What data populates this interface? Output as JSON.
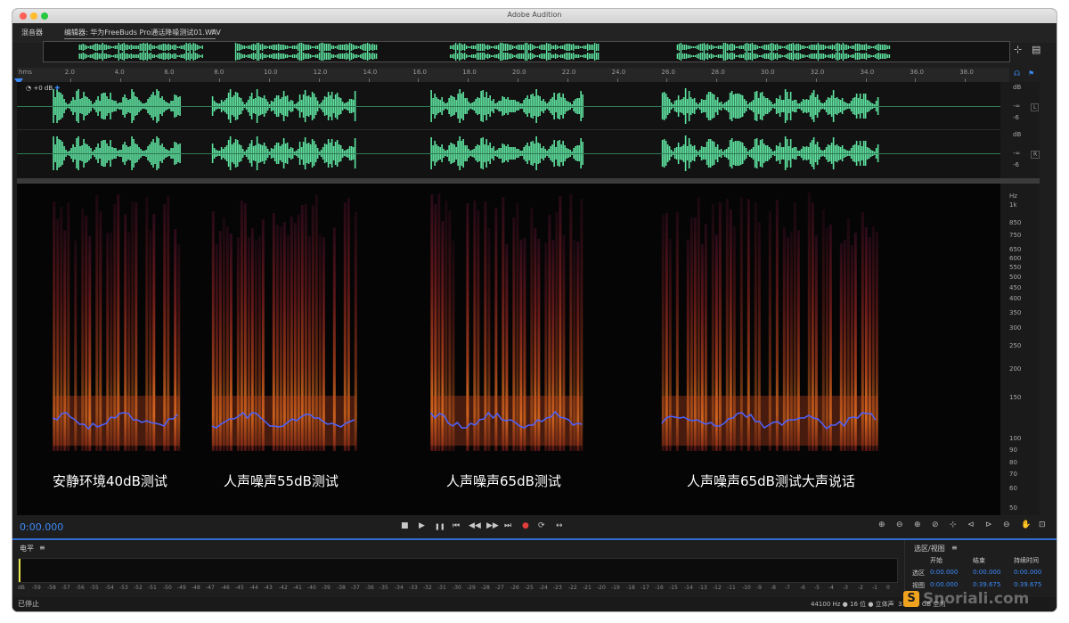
{
  "window": {
    "title": "Adobe Audition"
  },
  "tabs": {
    "mixer": "混音器",
    "editor": "编辑器: 华为FreeBuds Pro通话降噪测试01.WAV",
    "menu_glyph": "≡"
  },
  "ruler": {
    "unit": "hms",
    "labels": [
      "2.0",
      "4.0",
      "6.0",
      "8.0",
      "10.0",
      "12.0",
      "14.0",
      "16.0",
      "18.0",
      "20.0",
      "22.0",
      "24.0",
      "26.0",
      "28.0",
      "30.0",
      "32.0",
      "34.0",
      "36.0",
      "38.0"
    ]
  },
  "waveform": {
    "hud_volume": "+0 dB",
    "db_top": "dB",
    "db_inf": "-∞",
    "db_neg6": "-6",
    "left_tag": "L",
    "right_tag": "R"
  },
  "spectral": {
    "hz_unit": "Hz",
    "hz_labels": [
      "1k",
      "850",
      "750",
      "650",
      "600",
      "550",
      "500",
      "450",
      "400",
      "350",
      "300",
      "250",
      "200",
      "150",
      "100",
      "90",
      "80",
      "70",
      "60",
      "50"
    ],
    "captions": [
      "安静环境40dB测试",
      "人声噪声55dB测试",
      "人声噪声65dB测试",
      "人声噪声65dB测试大声说话"
    ]
  },
  "transport": {
    "timecode": "0:00.000",
    "stop": "■",
    "play": "▶",
    "pause": "❚❚",
    "to_start": "⏮",
    "rewind": "◀◀",
    "fast_forward": "▶▶",
    "to_end": "⏭",
    "record": "●",
    "loop": "⟳",
    "skip": "↔"
  },
  "levels": {
    "title": "电平",
    "menu": "≡",
    "scale": [
      "dB",
      "-59",
      "-58",
      "-57",
      "-56",
      "-55",
      "-54",
      "-53",
      "-52",
      "-51",
      "-50",
      "-49",
      "-48",
      "-47",
      "-46",
      "-45",
      "-44",
      "-43",
      "-42",
      "-41",
      "-40",
      "-39",
      "-38",
      "-37",
      "-36",
      "-35",
      "-34",
      "-33",
      "-32",
      "-31",
      "-30",
      "-29",
      "-28",
      "-27",
      "-26",
      "-25",
      "-24",
      "-23",
      "-22",
      "-21",
      "-20",
      "-19",
      "-18",
      "-17",
      "-16",
      "-15",
      "-14",
      "-13",
      "-12",
      "-11",
      "-10",
      "-9",
      "-8",
      "-7",
      "-6",
      "-5",
      "-4",
      "-3",
      "-2",
      "-1",
      "0"
    ]
  },
  "selection": {
    "title": "选区/视图",
    "menu": "≡",
    "headers": {
      "start": "开始",
      "end": "结束",
      "duration": "持续时间"
    },
    "rows": [
      {
        "label": "选区",
        "start": "0:00.000",
        "end": "0:00.000",
        "duration": "0:00.000"
      },
      {
        "label": "视图",
        "start": "0:00.000",
        "end": "0:39.675",
        "duration": "0:39.675"
      }
    ]
  },
  "status": {
    "state": "已停止",
    "info": "44100 Hz ● 16 位 ● 立体声",
    "size": "312.77 GB 空闲",
    "partial": "0:39.675"
  },
  "watermark": {
    "text": "Snoriali.com"
  },
  "colors": {
    "accent": "#3d8af7",
    "waveform": "#5ee3a0",
    "record": "#e23c3c"
  }
}
